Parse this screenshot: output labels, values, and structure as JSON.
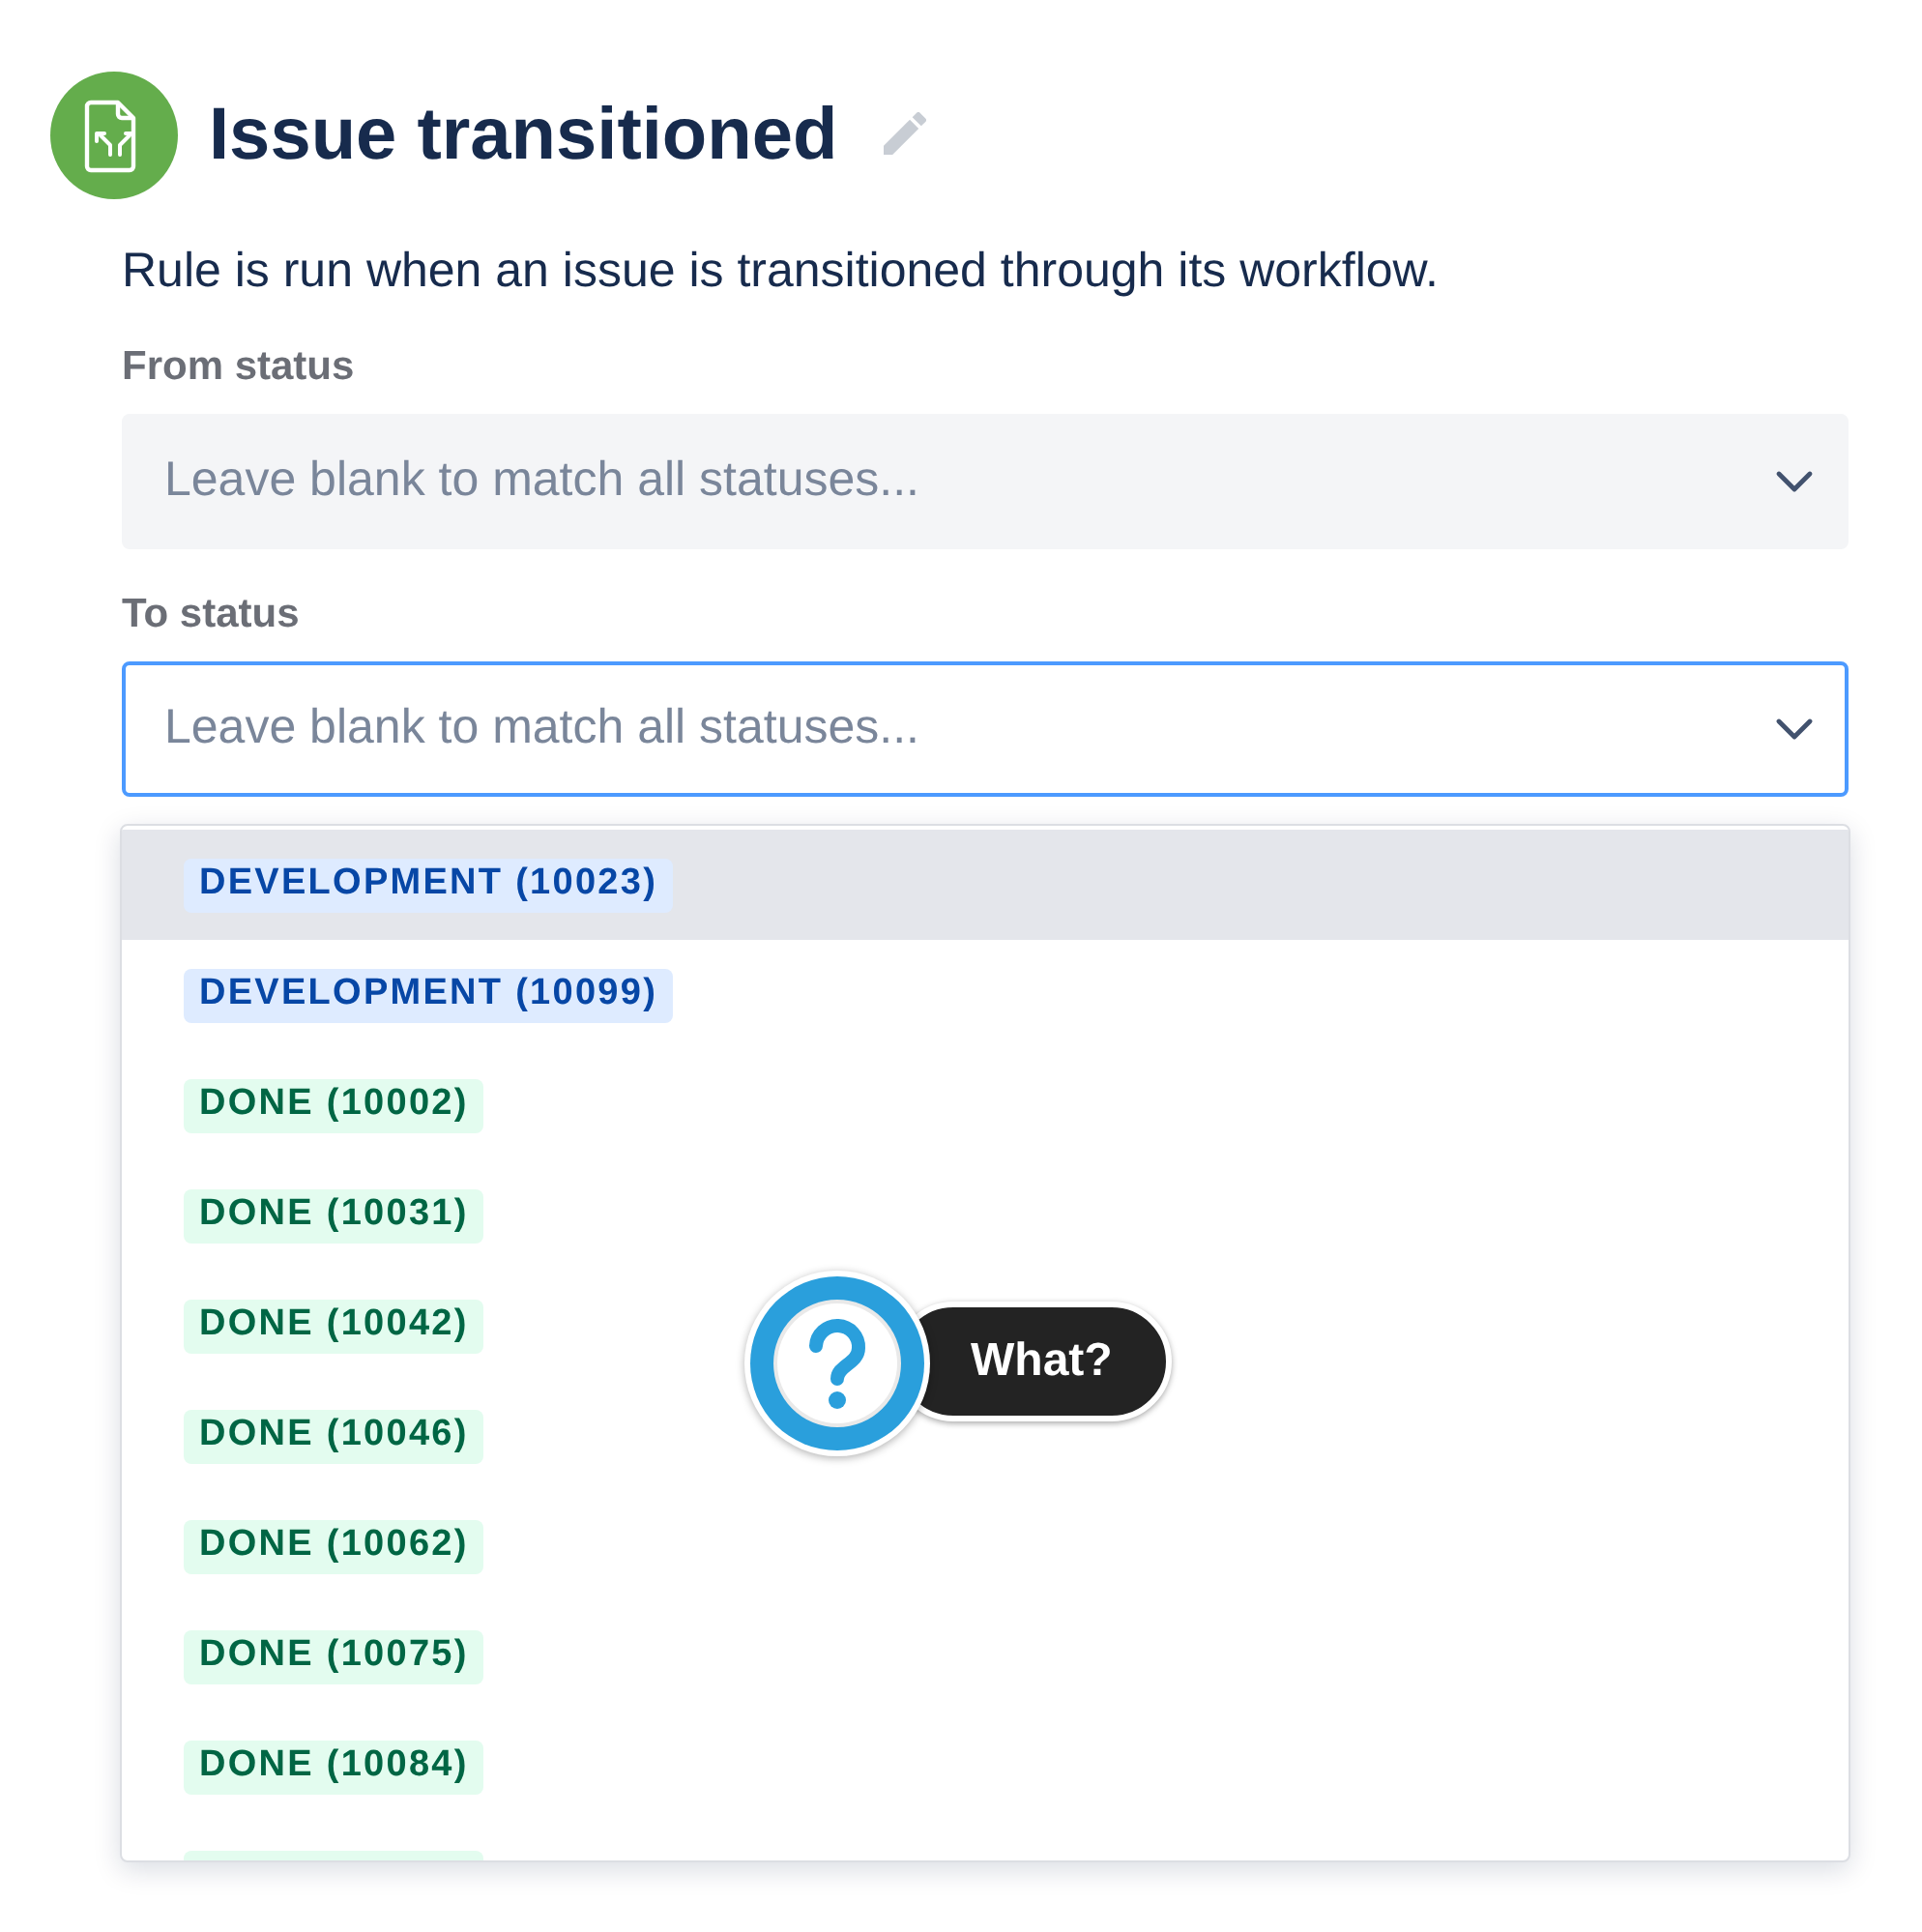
{
  "rule": {
    "title": "Issue transitioned",
    "description": "Rule is run when an issue is transitioned through its workflow."
  },
  "fields": [
    {
      "label": "From status",
      "placeholder": "Leave blank to match all statuses...",
      "focused": false
    },
    {
      "label": "To status",
      "placeholder": "Leave blank to match all statuses...",
      "focused": true
    }
  ],
  "menu": {
    "options": [
      {
        "label": "DEVELOPMENT (10023)",
        "kind": "development",
        "selected": true
      },
      {
        "label": "DEVELOPMENT (10099)",
        "kind": "development",
        "selected": false
      },
      {
        "label": "DONE (10002)",
        "kind": "done",
        "selected": false
      },
      {
        "label": "DONE (10031)",
        "kind": "done",
        "selected": false
      },
      {
        "label": "DONE (10042)",
        "kind": "done",
        "selected": false
      },
      {
        "label": "DONE (10046)",
        "kind": "done",
        "selected": false
      },
      {
        "label": "DONE (10062)",
        "kind": "done",
        "selected": false
      },
      {
        "label": "DONE (10075)",
        "kind": "done",
        "selected": false
      },
      {
        "label": "DONE (10084)",
        "kind": "done",
        "selected": false
      }
    ],
    "more_below": true
  },
  "callout": {
    "label": "What?"
  }
}
